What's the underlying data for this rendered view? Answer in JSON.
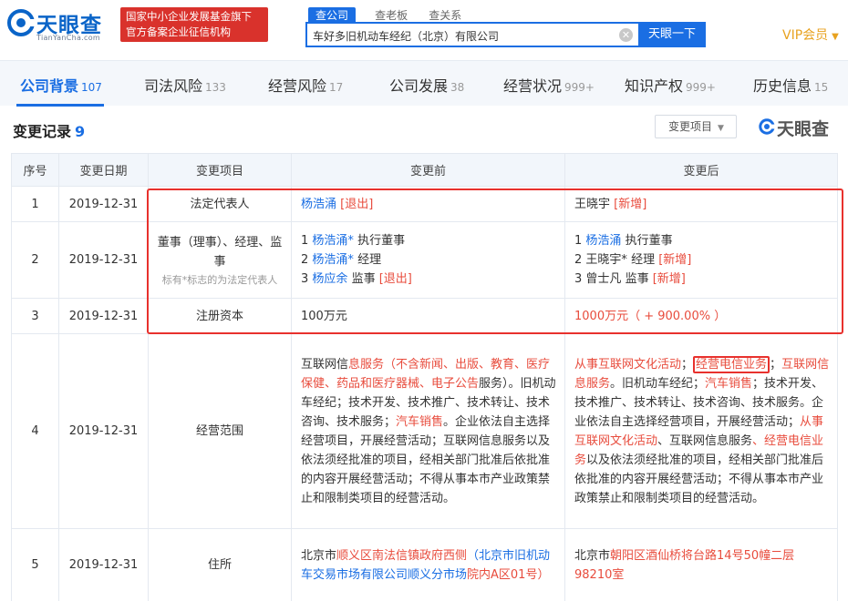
{
  "header": {
    "logo_name": "天眼查",
    "logo_domain": "TianYanCha.com",
    "badge_line1": "国家中小企业发展基金旗下",
    "badge_line2": "官方备案企业征信机构",
    "search_tabs": [
      "查公司",
      "查老板",
      "查关系"
    ],
    "search_value": "车好多旧机动车经纪（北京）有限公司",
    "clear_glyph": "✕",
    "search_button": "天眼一下",
    "vip_label": "VIP会员",
    "vip_caret": "▼"
  },
  "nav": {
    "items": [
      {
        "label": "公司背景",
        "count": "107"
      },
      {
        "label": "司法风险",
        "count": "133"
      },
      {
        "label": "经营风险",
        "count": "17"
      },
      {
        "label": "公司发展",
        "count": "38"
      },
      {
        "label": "经营状况",
        "count": "999+"
      },
      {
        "label": "知识产权",
        "count": "999+"
      },
      {
        "label": "历史信息",
        "count": "15"
      }
    ]
  },
  "section": {
    "title": "变更记录",
    "count": "9",
    "filter_label": "变更项目",
    "filter_caret": "▼",
    "watermark": "天眼查"
  },
  "table": {
    "headers": [
      "序号",
      "变更日期",
      "变更项目",
      "变更前",
      "变更后"
    ],
    "r1": {
      "no": "1",
      "date": "2019-12-31",
      "item": "法定代表人",
      "before_name": "杨浩涌",
      "before_tag": "[退出]",
      "after_name": "王晓宇",
      "after_tag": "[新增]"
    },
    "r2": {
      "no": "2",
      "date": "2019-12-31",
      "item": "董事（理事）、经理、监事",
      "item_note": "标有*标志的为法定代表人",
      "b1_no": "1",
      "b1_name": "杨浩涌*",
      "b1_role": "执行董事",
      "b2_no": "2",
      "b2_name": "杨浩涌*",
      "b2_role": "经理",
      "b3_no": "3",
      "b3_name": "杨应余",
      "b3_role": "监事",
      "b3_tag": "[退出]",
      "a1_no": "1",
      "a1_name": "杨浩涌",
      "a1_role": "执行董事",
      "a2_no": "2",
      "a2_name": "王晓宇*",
      "a2_role": "经理",
      "a2_tag": "[新增]",
      "a3_no": "3",
      "a3_name": "曾士凡",
      "a3_role": "监事",
      "a3_tag": "[新增]"
    },
    "r3": {
      "no": "3",
      "date": "2019-12-31",
      "item": "注册资本",
      "before": "100万元",
      "after": "1000万元（ + 900.00% ）"
    },
    "r4": {
      "no": "4",
      "date": "2019-12-31",
      "item": "经营范围",
      "b_p1": "互联网信",
      "b_p2": "息服务",
      "b_p3": "（",
      "b_p4": "不含新闻、出版、教育、医疗保健、药品和医疗器械、电子公告",
      "b_p5": "服务）。旧机动车经纪；技术开发、技术推广、技术转让、技术咨询、技术服务；",
      "b_p6": "汽车销售",
      "b_p7": "。企业依法自主选择经营项目，开展经营活动；互联网信息服务以及依法须经批准的项目，经相关部门批准后依批准的内容开展经营活动；不得从事本市产业政策禁止和限制类项目的经营活动。",
      "a_p1": "从事互联网文化活动",
      "a_p2": "；",
      "a_p3": "经营电信业务",
      "a_p4": "；",
      "a_p5": "互联网信息服务",
      "a_p6": "。旧机动车经纪；",
      "a_p7": "汽车销售",
      "a_p8": "；技术开发、技术推广、技术转让、技术咨询、技术服务。企业依法自主选择经营项目，开展经营活动；",
      "a_p9": "从事互联网文化活动",
      "a_p10": "、互联网信息服务",
      "a_p11": "、经营电信业务",
      "a_p12": "以及依法须经批准的项目，经相关部门批准后依批准的内容开展经营活动；不得从事本市产业政策禁止和限制类项目的经营活动。"
    },
    "r5": {
      "no": "5",
      "date": "2019-12-31",
      "item": "住所",
      "b_p1": "北京市",
      "b_p2": "顺义区",
      "b_p3": "南法信镇政府西侧",
      "b_p4": "（北京市旧机动车交易市场有限公司顺义分市场",
      "b_p5": "院内A区01号）",
      "a_p1": "北京市",
      "a_p2": "朝阳区",
      "a_p3": "酒仙桥将台路14号50幢二层98210室"
    }
  },
  "colors": {
    "brand_blue": "#1a6ee3",
    "badge_red": "#d9322c",
    "highlight_red": "#e8312d",
    "vip_gold": "#e8a21f"
  }
}
